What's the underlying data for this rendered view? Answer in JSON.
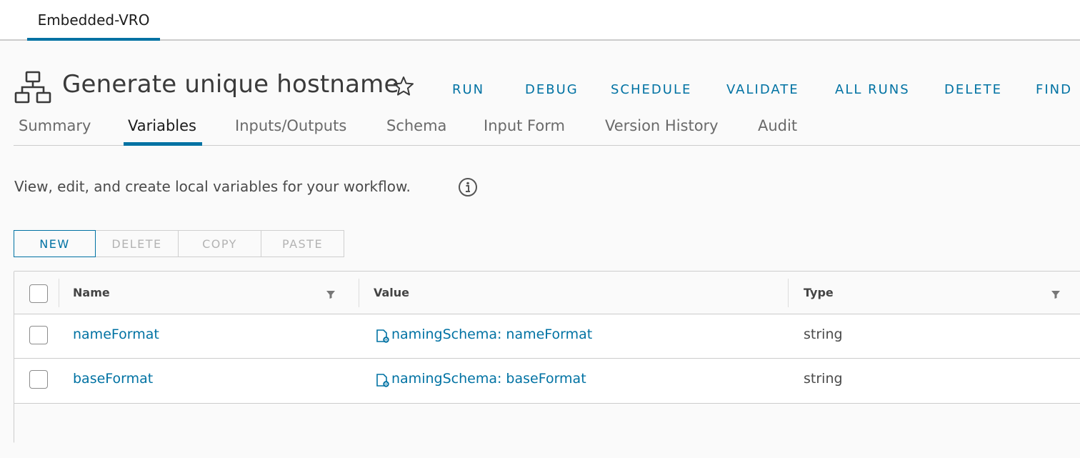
{
  "top_tab": {
    "label": "Embedded-VRO"
  },
  "workflow": {
    "title": "Generate unique hostname",
    "icon": "workflow-icon",
    "favorite_icon": "star-icon"
  },
  "actions": [
    "RUN",
    "DEBUG",
    "SCHEDULE",
    "VALIDATE",
    "ALL RUNS",
    "DELETE",
    "FIND"
  ],
  "tabs": {
    "items": [
      "Summary",
      "Variables",
      "Inputs/Outputs",
      "Schema",
      "Input Form",
      "Version History",
      "Audit"
    ],
    "active": "Variables"
  },
  "description": "View, edit, and create local variables for your workflow.",
  "toolbar": {
    "new": "NEW",
    "delete": "DELETE",
    "copy": "COPY",
    "paste": "PASTE"
  },
  "table": {
    "columns": [
      "Name",
      "Value",
      "Type"
    ],
    "rows": [
      {
        "name": "nameFormat",
        "value": "namingSchema: nameFormat",
        "type": "string"
      },
      {
        "name": "baseFormat",
        "value": "namingSchema: baseFormat",
        "type": "string"
      }
    ]
  },
  "colors": {
    "accent": "#0072a3",
    "text": "#333333",
    "border": "#cccccc"
  }
}
